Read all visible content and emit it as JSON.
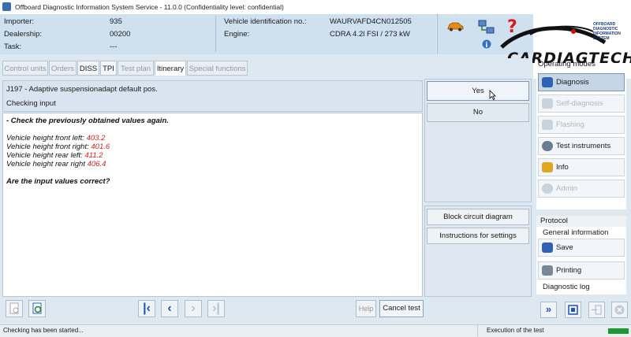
{
  "window": {
    "title": "Offboard Diagnostic Information System Service - 11.0.0 (Confidentiality level: confidential)"
  },
  "header": {
    "importer_label": "Importer:",
    "importer_value": "935",
    "dealership_label": "Dealership:",
    "dealership_value": "00200",
    "task_label": "Task:",
    "task_value": "---",
    "vin_label": "Vehicle identification no.:",
    "vin_value": "WAURVAFD4CN012505",
    "engine_label": "Engine:",
    "engine_value": "CDRA 4.2l FSI / 273 kW"
  },
  "logo": {
    "text": "CARDIAGTECH",
    "small_text": "OFFBOARD DIAGNOSTIC INFORMATION SYSTEM"
  },
  "tabs": [
    {
      "label": "Control units",
      "enabled": false
    },
    {
      "label": "Orders",
      "enabled": false
    },
    {
      "label": "DISS",
      "enabled": true
    },
    {
      "label": "TPI",
      "enabled": true
    },
    {
      "label": "Test plan",
      "enabled": false
    },
    {
      "label": "Itinerary",
      "enabled": true,
      "active": true
    },
    {
      "label": "Special functions",
      "enabled": false
    }
  ],
  "procedure": {
    "title": "J197 - Adaptive suspensionadapt default pos.",
    "subtitle": "Checking input"
  },
  "content": {
    "instruction": "- Check the previously obtained values again.",
    "values": [
      {
        "label": "Vehicle height front left:",
        "value": "403.2"
      },
      {
        "label": "Vehicle height front right:",
        "value": "401.6"
      },
      {
        "label": "Vehicle height rear left:",
        "value": "411.2"
      },
      {
        "label": "Vehicle height rear right",
        "value": "406.4"
      }
    ],
    "question": "Are the input values correct?"
  },
  "answers": {
    "yes": "Yes",
    "no": "No"
  },
  "side_buttons": {
    "block_diagram": "Block circuit diagram",
    "instructions": "Instructions for settings"
  },
  "operating_modes": {
    "heading": "Operating modes",
    "items": [
      {
        "label": "Diagnosis",
        "state": "selected",
        "icon": "diagnosis-icon"
      },
      {
        "label": "Self-diagnosis",
        "state": "disabled",
        "icon": "self-diagnosis-icon"
      },
      {
        "label": "Flashing",
        "state": "disabled",
        "icon": "flashing-icon"
      },
      {
        "label": "Test instruments",
        "state": "enabled",
        "icon": "test-instruments-icon"
      },
      {
        "label": "Info",
        "state": "enabled",
        "icon": "info-icon"
      },
      {
        "label": "Admin",
        "state": "disabled",
        "icon": "admin-icon"
      }
    ]
  },
  "protocol": {
    "heading": "Protocol",
    "general_info": "General information",
    "save": "Save",
    "printing": "Printing",
    "diagnostic_log": "Diagnostic log"
  },
  "toolbar": {
    "help": "Help",
    "cancel_test": "Cancel test"
  },
  "status": {
    "left": "Checking has been started...",
    "right": "Execution of the test"
  },
  "colors": {
    "value_red": "#d21f1f",
    "accent_blue": "#1d55b4",
    "status_green": "#1b9a2f"
  }
}
